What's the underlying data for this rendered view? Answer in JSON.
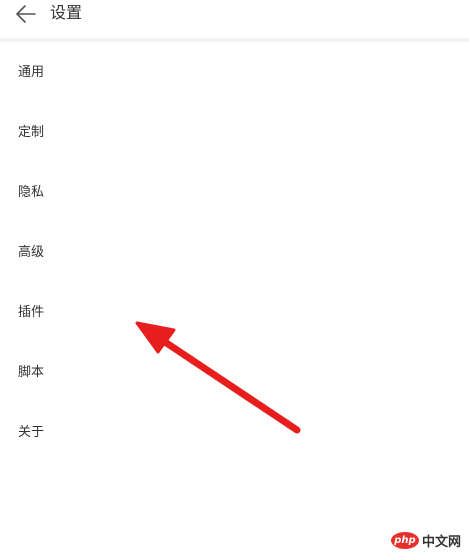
{
  "header": {
    "back_icon": "arrow-left-icon",
    "title": "设置"
  },
  "menu": {
    "items": [
      {
        "label": "通用"
      },
      {
        "label": "定制"
      },
      {
        "label": "隐私"
      },
      {
        "label": "高级"
      },
      {
        "label": "插件"
      },
      {
        "label": "脚本"
      },
      {
        "label": "关于"
      }
    ]
  },
  "annotation": {
    "arrow_icon": "red-arrow-icon",
    "color": "#e81e1e"
  },
  "watermark": {
    "logo_text": "php",
    "text": "中文网",
    "color": "#e8302a"
  }
}
